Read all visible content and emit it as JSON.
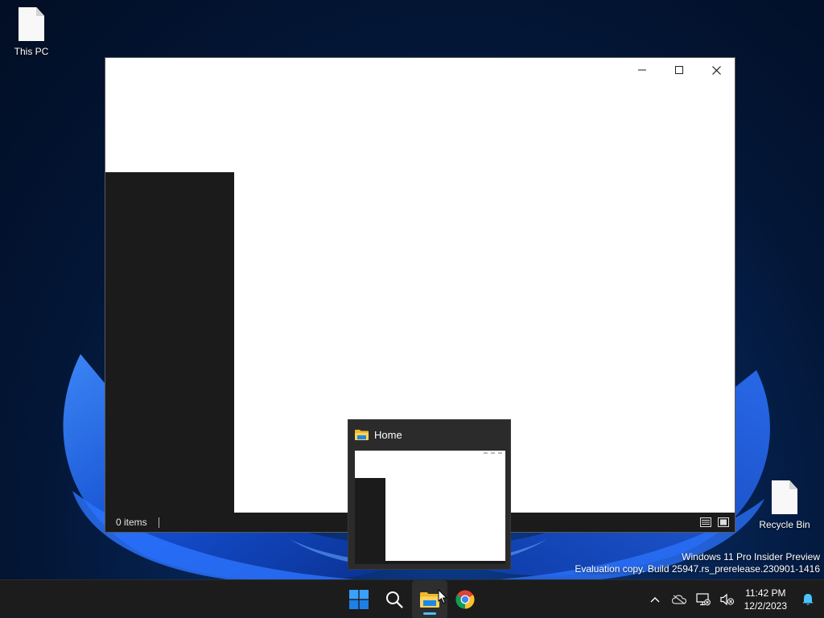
{
  "desktop": {
    "icons": [
      {
        "label": "This PC"
      },
      {
        "label": "Recycle Bin"
      }
    ],
    "watermark": {
      "line1": "Windows 11 Pro Insider Preview",
      "line2": "Evaluation copy. Build 25947.rs_prerelease.230901-1416"
    }
  },
  "window": {
    "status": {
      "items_text": "0 items"
    },
    "view_modes": [
      "details-view",
      "large-icons-view"
    ]
  },
  "preview": {
    "title": "Home"
  },
  "taskbar": {
    "apps": [
      "start",
      "search",
      "file-explorer",
      "chrome"
    ],
    "active_app": "file-explorer",
    "clock": {
      "time": "11:42 PM",
      "date": "12/2/2023"
    }
  },
  "colors": {
    "accent": "#4cc2ff",
    "taskbar": "#1c1c1c",
    "dark_pane": "#1b1b1b"
  }
}
